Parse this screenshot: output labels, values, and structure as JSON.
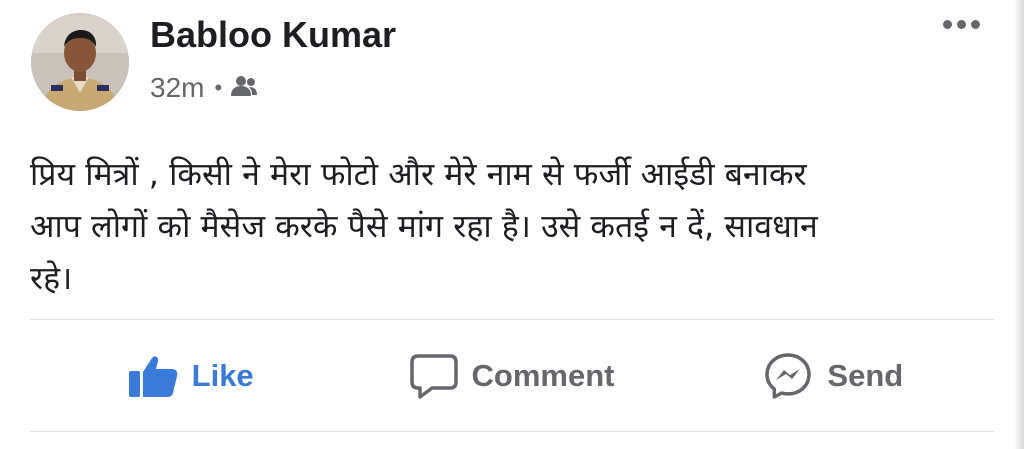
{
  "post": {
    "author": "Babloo Kumar",
    "time": "32m",
    "separator": "•",
    "audience_icon": "friends-icon",
    "more_icon": "more-options-icon",
    "text_lines": [
      "प्रिय मित्रों , किसी ने मेरा फोटो और मेरे नाम से फर्जी आईडी बनाकर",
      "आप लोगों को मैसेज करके पैसे मांग रहा है। उसे कतई न दें, सावधान",
      "रहे।"
    ]
  },
  "actions": {
    "like_label": "Like",
    "comment_label": "Comment",
    "send_label": "Send",
    "like_icon": "thumbs-up-icon",
    "comment_icon": "comment-bubble-icon",
    "send_icon": "messenger-icon"
  },
  "colors": {
    "like_blue": "#3a7ad9",
    "text_primary": "#1c1e21",
    "text_secondary": "#65676b",
    "divider": "#dadde1"
  }
}
